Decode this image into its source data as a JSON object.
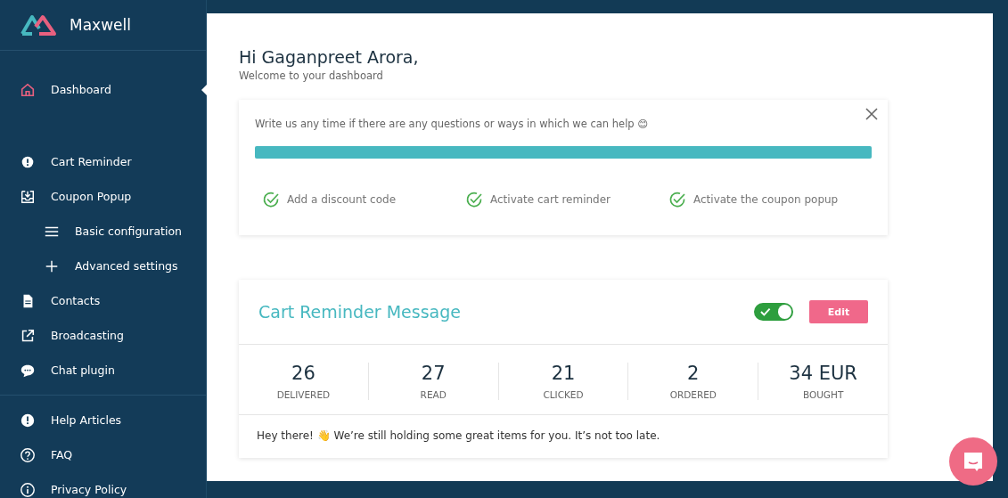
{
  "brand": {
    "name": "Maxwell"
  },
  "sidebar": {
    "groups": [
      [
        {
          "label": "Dashboard",
          "kind": "home",
          "selected": true
        }
      ],
      [
        {
          "label": "Cart Reminder",
          "kind": "alert-bubble",
          "selected": false
        },
        {
          "label": "Coupon Popup",
          "kind": "inbox",
          "selected": false,
          "children": [
            {
              "label": "Basic configuration",
              "kind": "menu",
              "selected": false
            },
            {
              "label": "Advanced settings",
              "kind": "plus",
              "selected": false
            }
          ]
        },
        {
          "label": "Contacts",
          "kind": "document",
          "selected": false
        },
        {
          "label": "Broadcasting",
          "kind": "external",
          "selected": false
        },
        {
          "label": "Chat plugin",
          "kind": "chat",
          "selected": false
        }
      ],
      [
        {
          "label": "Help Articles",
          "kind": "alert",
          "selected": false
        },
        {
          "label": "FAQ",
          "kind": "question",
          "selected": false
        },
        {
          "label": "Privacy Policy",
          "kind": "info",
          "selected": false
        }
      ]
    ]
  },
  "greeting": {
    "title": "Hi Gaganpreet Arora,",
    "subtitle": "Welcome to your dashboard"
  },
  "onboarding": {
    "message": "Write us any time if there are any questions or ways in which we can help 😊",
    "progress": {
      "level": 1
    },
    "steps": [
      {
        "label": "Add a discount code",
        "checked": true
      },
      {
        "label": "Activate cart reminder",
        "checked": true
      },
      {
        "label": "Activate the coupon popup",
        "checked": true
      }
    ]
  },
  "cart_reminder": {
    "title": "Cart Reminder Message",
    "enabled": true,
    "edit_button": "Edit",
    "stats": [
      {
        "value": "26",
        "label": "DELIVERED"
      },
      {
        "value": "27",
        "label": "READ"
      },
      {
        "value": "21",
        "label": "CLICKED"
      },
      {
        "value": "2",
        "label": "ORDERED"
      },
      {
        "value": "34 EUR",
        "label": "BOUGHT"
      }
    ],
    "message": "Hey there! 👋  We’re still holding some great items for you. It’s not too late."
  }
}
